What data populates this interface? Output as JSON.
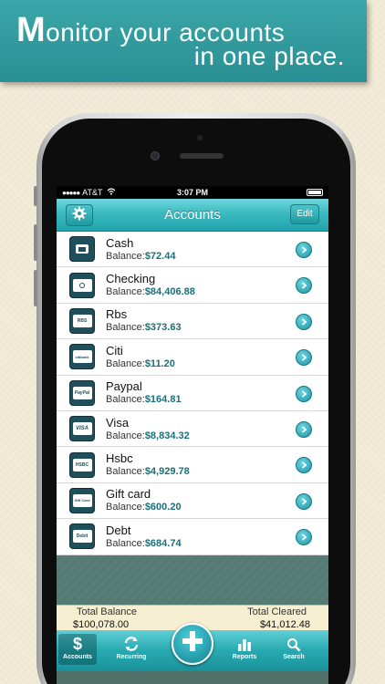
{
  "banner": {
    "line1_first": "M",
    "line1_rest": "onitor your accounts",
    "line2": "in one place."
  },
  "status_bar": {
    "carrier": "AT&T",
    "time": "3:07 PM"
  },
  "nav": {
    "title": "Accounts",
    "edit_label": "Edit"
  },
  "accounts": [
    {
      "name": "Cash",
      "balance_label": "Balance:",
      "balance": "$72.44",
      "icon": "cash-icon",
      "icon_text": ""
    },
    {
      "name": "Checking",
      "balance_label": "Balance:",
      "balance": "$84,406.88",
      "icon": "checking-icon",
      "icon_text": ""
    },
    {
      "name": "Rbs",
      "balance_label": "Balance:",
      "balance": "$373.63",
      "icon": "rbs-card-icon",
      "icon_text": "RBS"
    },
    {
      "name": "Citi",
      "balance_label": "Balance:",
      "balance": "$11.20",
      "icon": "citi-card-icon",
      "icon_text": "citibank"
    },
    {
      "name": "Paypal",
      "balance_label": "Balance:",
      "balance": "$164.81",
      "icon": "paypal-icon",
      "icon_text": "PayPal"
    },
    {
      "name": "Visa",
      "balance_label": "Balance:",
      "balance": "$8,834.32",
      "icon": "visa-card-icon",
      "icon_text": "VISA"
    },
    {
      "name": "Hsbc",
      "balance_label": "Balance:",
      "balance": "$4,929.78",
      "icon": "hsbc-card-icon",
      "icon_text": "HSBC"
    },
    {
      "name": "Gift card",
      "balance_label": "Balance:",
      "balance": "$600.20",
      "icon": "gift-card-icon",
      "icon_text": "Gift Card"
    },
    {
      "name": "Debt",
      "balance_label": "Balance:",
      "balance": "$684.74",
      "icon": "debit-card-icon",
      "icon_text": "Debit"
    }
  ],
  "totals": {
    "balance_label": "Total Balance",
    "balance_value": "$100,078.00",
    "cleared_label": "Total Cleared",
    "cleared_value": "$41,012.48"
  },
  "tabs": {
    "accounts": "Accounts",
    "recurring": "Recurring",
    "reports": "Reports",
    "search": "Search"
  },
  "colors": {
    "banner": "#2f9a9d",
    "accent": "#22a3ab",
    "balance_text": "#1a6f78"
  }
}
